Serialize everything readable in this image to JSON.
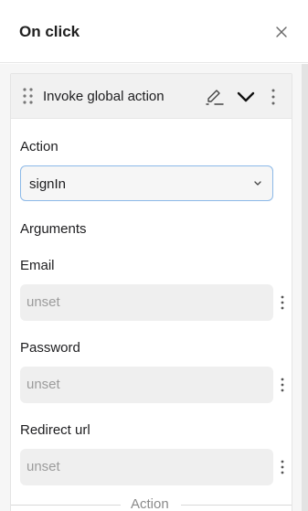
{
  "header": {
    "title": "On click",
    "close_icon": "close-icon"
  },
  "action_card": {
    "title": "Invoke global action",
    "icons": [
      "drag-handle-icon",
      "edit-icon",
      "chevron-down-icon",
      "more-vertical-icon"
    ],
    "action_label": "Action",
    "action_value": "signIn",
    "arguments_label": "Arguments",
    "fields": [
      {
        "label": "Email",
        "placeholder": "unset"
      },
      {
        "label": "Password",
        "placeholder": "unset"
      },
      {
        "label": "Redirect url",
        "placeholder": "unset"
      }
    ]
  },
  "footer_divider": {
    "label": "Action"
  }
}
